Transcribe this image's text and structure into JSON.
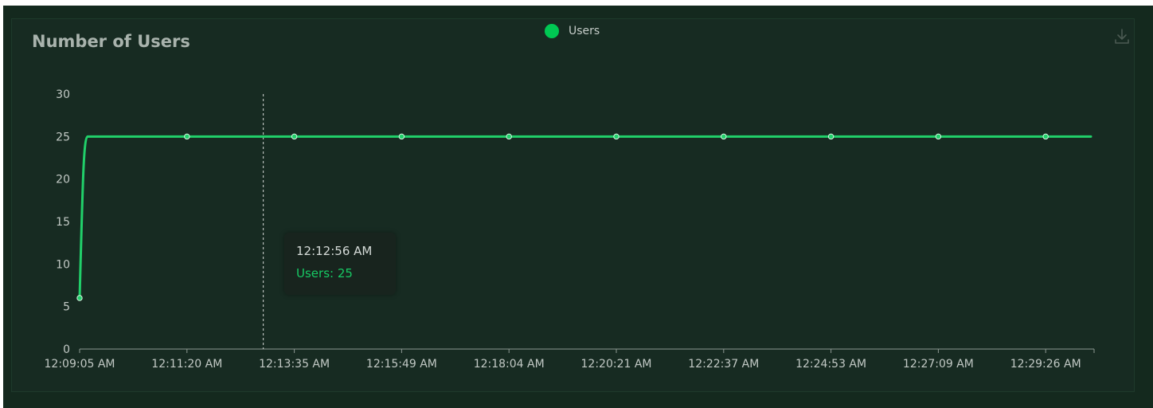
{
  "panel": {
    "title": "Number of Users"
  },
  "legend": {
    "label": "Users",
    "color": "#00c853"
  },
  "toolbar": {
    "download_icon": "download-icon"
  },
  "tooltip": {
    "time": "12:12:56 AM",
    "series": "Users",
    "value": "25",
    "text": "Users: 25"
  },
  "colors": {
    "line": "#21d06a",
    "axis": "#8e9893",
    "background": "#172b22"
  },
  "chart_data": {
    "type": "line",
    "title": "Number of Users",
    "x_tick_labels": [
      "12:09:05 AM",
      "12:11:20 AM",
      "12:13:35 AM",
      "12:15:49 AM",
      "12:18:04 AM",
      "12:20:21 AM",
      "12:22:37 AM",
      "12:24:53 AM",
      "12:27:09 AM",
      "12:29:26 AM"
    ],
    "x": [
      "12:09:05 AM",
      "12:11:20 AM",
      "12:13:35 AM",
      "12:15:49 AM",
      "12:18:04 AM",
      "12:20:21 AM",
      "12:22:37 AM",
      "12:24:53 AM",
      "12:27:09 AM",
      "12:29:26 AM"
    ],
    "series": [
      {
        "name": "Users",
        "values": [
          6,
          25,
          25,
          25,
          25,
          25,
          25,
          25,
          25,
          25
        ]
      }
    ],
    "y_ticks": [
      0,
      5,
      10,
      15,
      20,
      25,
      30
    ],
    "ylim": [
      0,
      30
    ],
    "grid": false,
    "legend_position": "top-center",
    "hover_x": "12:12:56 AM"
  }
}
